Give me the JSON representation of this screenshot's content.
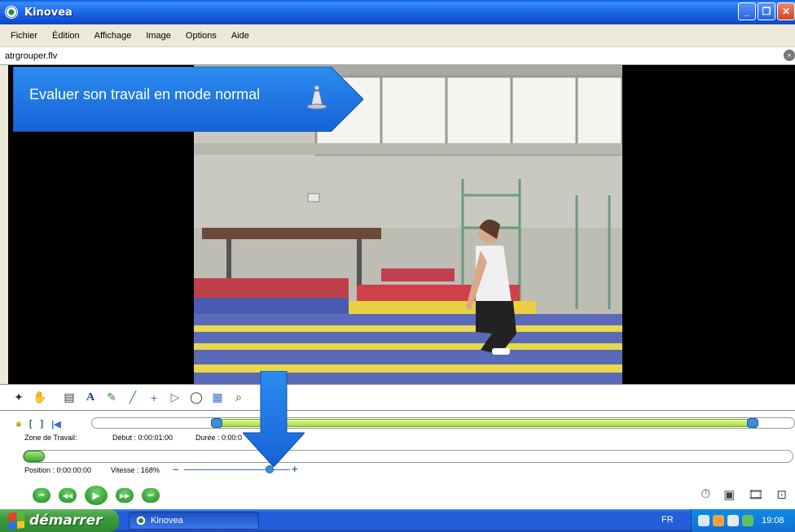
{
  "window": {
    "title": "Kinovea",
    "controls": [
      "_",
      "❐",
      "✕"
    ]
  },
  "menu": [
    "Fichier",
    "Édition",
    "Affichage",
    "Image",
    "Options",
    "Aide"
  ],
  "file": {
    "name": "atrgrouper.flv"
  },
  "callout": {
    "text": "Evaluer son travail en mode normal"
  },
  "timeline": {
    "zone_label": "Zone de Travail:",
    "debut_label": "Début : 0:00:01:00",
    "duree_label": "Durée : 0:00:0",
    "position_label": "Position : 0:00:00:00",
    "speed_label": "Vitesse : 168%",
    "speed_minus": "–",
    "speed_plus": "+",
    "speed_percent": 168
  },
  "transport": [
    "⏮",
    "◀◀",
    "▶",
    "▶▶",
    "⏭"
  ],
  "taskbar": {
    "start_label": "démarrer",
    "task_item": "Kinovea",
    "language": "FR",
    "clock": "19:08"
  },
  "colors": {
    "title_blue": "#1f6ee8",
    "callout_blue": "#1e78e6",
    "work_zone_green": "#a7d83a",
    "start_green": "#3c9a3c"
  }
}
